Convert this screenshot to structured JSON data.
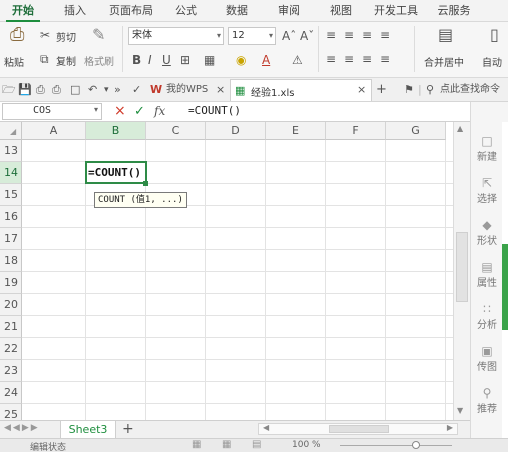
{
  "ribbon_tabs": [
    "开始",
    "插入",
    "页面布局",
    "公式",
    "数据",
    "审阅",
    "视图",
    "开发工具",
    "云服务"
  ],
  "ribbon": {
    "paste": "粘贴",
    "cut": "剪切",
    "copy": "复制",
    "format_painter": "格式刷",
    "font_name": "宋体",
    "font_size": "12",
    "merge": "合并居中",
    "autowrap": "自动"
  },
  "quickbar": {
    "my_wps": "我的WPS",
    "doc_name": "经验1.xls",
    "search": "点此查找命令"
  },
  "formula_bar": {
    "name_box": "COS",
    "fx": "fx",
    "formula": "=COUNT()"
  },
  "grid": {
    "columns": [
      "A",
      "B",
      "C",
      "D",
      "E",
      "F",
      "G"
    ],
    "rows": [
      "13",
      "14",
      "15",
      "16",
      "17",
      "18",
      "19",
      "20",
      "21",
      "22",
      "23",
      "24",
      "25"
    ],
    "active_cell_text": "=COUNT()",
    "tooltip": "COUNT (值1, ...)"
  },
  "side_panel": [
    "新建",
    "选择",
    "形状",
    "属性",
    "分析",
    "传图",
    "推荐"
  ],
  "sheets": [
    "Sheet3"
  ],
  "status": {
    "mode": "编辑状态",
    "zoom": "100 %"
  },
  "colors": {
    "accent": "#1e8e3e",
    "selected_header": "#d7ecd9"
  }
}
